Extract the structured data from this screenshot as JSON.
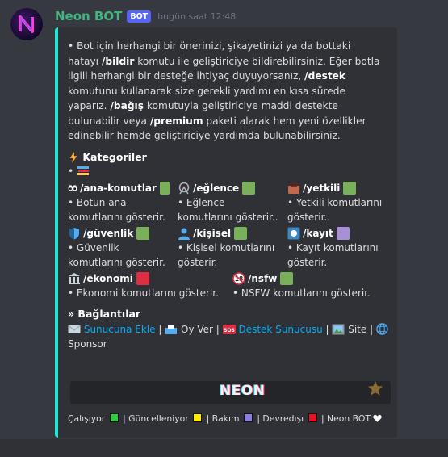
{
  "message": {
    "author": "Neon BOT",
    "bot_tag": "BOT",
    "timestamp": "bugün saat 12:48",
    "accent_color": "#1de9d6",
    "author_color": "#43b581"
  },
  "embed": {
    "description": {
      "p1": "• Bot için herhangi bir önerinizi, şikayetinizi ya da bottaki hatayı ",
      "cmd_bildir": "/bildir",
      "p2": " komutu ile geliştiriciye bildirebilirsiniz. Eğer botla ilgili herhangi bir desteğe ihtiyaç duyuyorsanız, ",
      "cmd_destek": "/destek",
      "p3": " komutunu kullanarak size gerekli yardımı en kısa sürede yaparız. ",
      "cmd_bagis": "/bağış",
      "p4": " komutuyla geliştiriciye maddi destekte bulunabilir veya ",
      "cmd_premium": "/premium",
      "p5": " paketi alarak hem yeni özellikler edinebilir hemde geliştiriciye yardımda bulunabilirsiniz."
    },
    "categories_title": "Kategoriler",
    "categories_bullet": "•",
    "categories": [
      {
        "command": "/ana-komutlar",
        "desc": "• Botun ana komutlarını gösterir.",
        "icon": "eyes-icon",
        "status": "green"
      },
      {
        "command": "/eğlence",
        "desc": "• Eğlence komutlarını gösterir..",
        "icon": "ferris-wheel-icon",
        "status": "green"
      },
      {
        "command": "/yetkili",
        "desc": "• Yetkili komutlarını gösterir..",
        "icon": "briefcase-icon",
        "status": "green"
      },
      {
        "command": "/güvenlik",
        "desc": "• Güvenlik komutlarını gösterir.",
        "icon": "shield-icon",
        "status": "green"
      },
      {
        "command": "/kişisel",
        "desc": "• Kişisel komutlarını gösterir.",
        "icon": "person-icon",
        "status": "green"
      },
      {
        "command": "/kayıt",
        "desc": "• Kayıt komutlarını gösterir.",
        "icon": "record-button-icon",
        "status": "purple"
      },
      {
        "command": "/ekonomi",
        "desc": "• Ekonomi komutlarını gösterir.",
        "icon": "bank-icon",
        "status": "red"
      },
      {
        "command": "/nsfw",
        "desc": "• NSFW komutlarını gösterir.",
        "icon": "no-under-18-icon",
        "status": "green"
      }
    ],
    "links_title": "» Bağlantılar",
    "links": {
      "add": "Sunucuna Ekle",
      "sep1": " | ",
      "vote": "Oy Ver",
      "sep2": " | ",
      "support": "Destek Sunucusu",
      "sep3": " | ",
      "site": "Site",
      "sep4": " | ",
      "sponsor": "Sponsor"
    },
    "image_text": "NEON",
    "footer": {
      "working": "Çalışıyor",
      "updating": "| Güncelleniyor",
      "maintenance": "| Bakım",
      "disabled": "| Devredışı",
      "brand": "| Neon BOT"
    },
    "colors": {
      "green": "#78b159",
      "red": "#dd2e44",
      "purple": "#aa8ed6",
      "yellow": "#fdcb58",
      "link": "#00aff4"
    }
  }
}
